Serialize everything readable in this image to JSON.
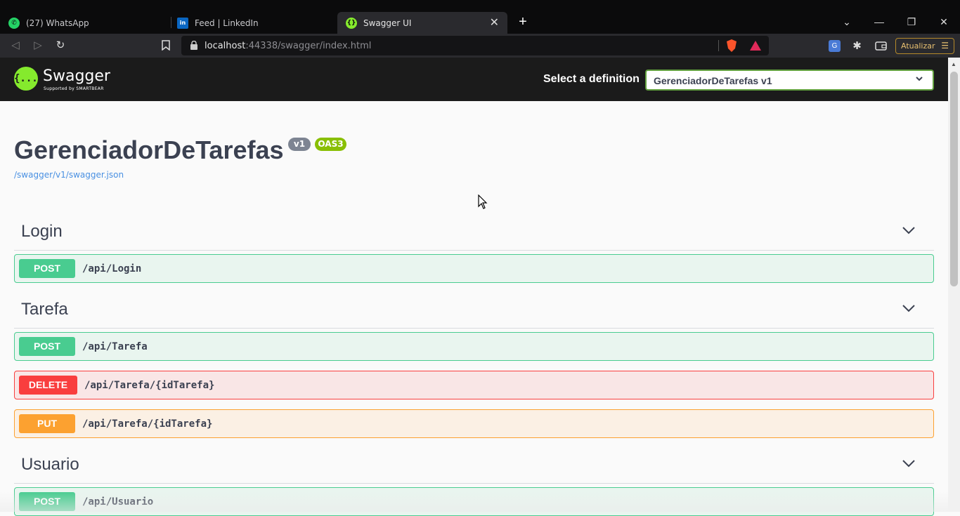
{
  "browser": {
    "tabs": [
      {
        "title": "(27) WhatsApp",
        "icon": "whatsapp-icon",
        "color": "#25d366"
      },
      {
        "title": "Feed | LinkedIn",
        "icon": "linkedin-icon",
        "color": "#0a66c2"
      },
      {
        "title": "Swagger UI",
        "icon": "swagger-icon",
        "color": "#85ea2d",
        "active": true
      }
    ],
    "url_host": "localhost",
    "url_rest": ":44338/swagger/index.html",
    "update_label": "Atualizar"
  },
  "swagger": {
    "logo_text": "Swagger",
    "logo_mark": "{...}",
    "logo_sub": "Supported by SMARTBEAR",
    "definition_label": "Select a definition",
    "definition_value": "GerenciadorDeTarefas v1",
    "api_title": "GerenciadorDeTarefas",
    "version_badge": "v1",
    "oas_badge": "OAS3",
    "spec_link": "/swagger/v1/swagger.json",
    "tags": [
      {
        "name": "Login",
        "operations": [
          {
            "method": "POST",
            "path": "/api/Login"
          }
        ]
      },
      {
        "name": "Tarefa",
        "operations": [
          {
            "method": "POST",
            "path": "/api/Tarefa"
          },
          {
            "method": "DELETE",
            "path": "/api/Tarefa/{idTarefa}"
          },
          {
            "method": "PUT",
            "path": "/api/Tarefa/{idTarefa}"
          }
        ]
      },
      {
        "name": "Usuario",
        "operations": [
          {
            "method": "POST",
            "path": "/api/Usuario"
          }
        ]
      }
    ]
  },
  "colors": {
    "post": "#49cc90",
    "delete": "#f93e3e",
    "put": "#fca130",
    "swagger_green": "#85ea2d"
  }
}
